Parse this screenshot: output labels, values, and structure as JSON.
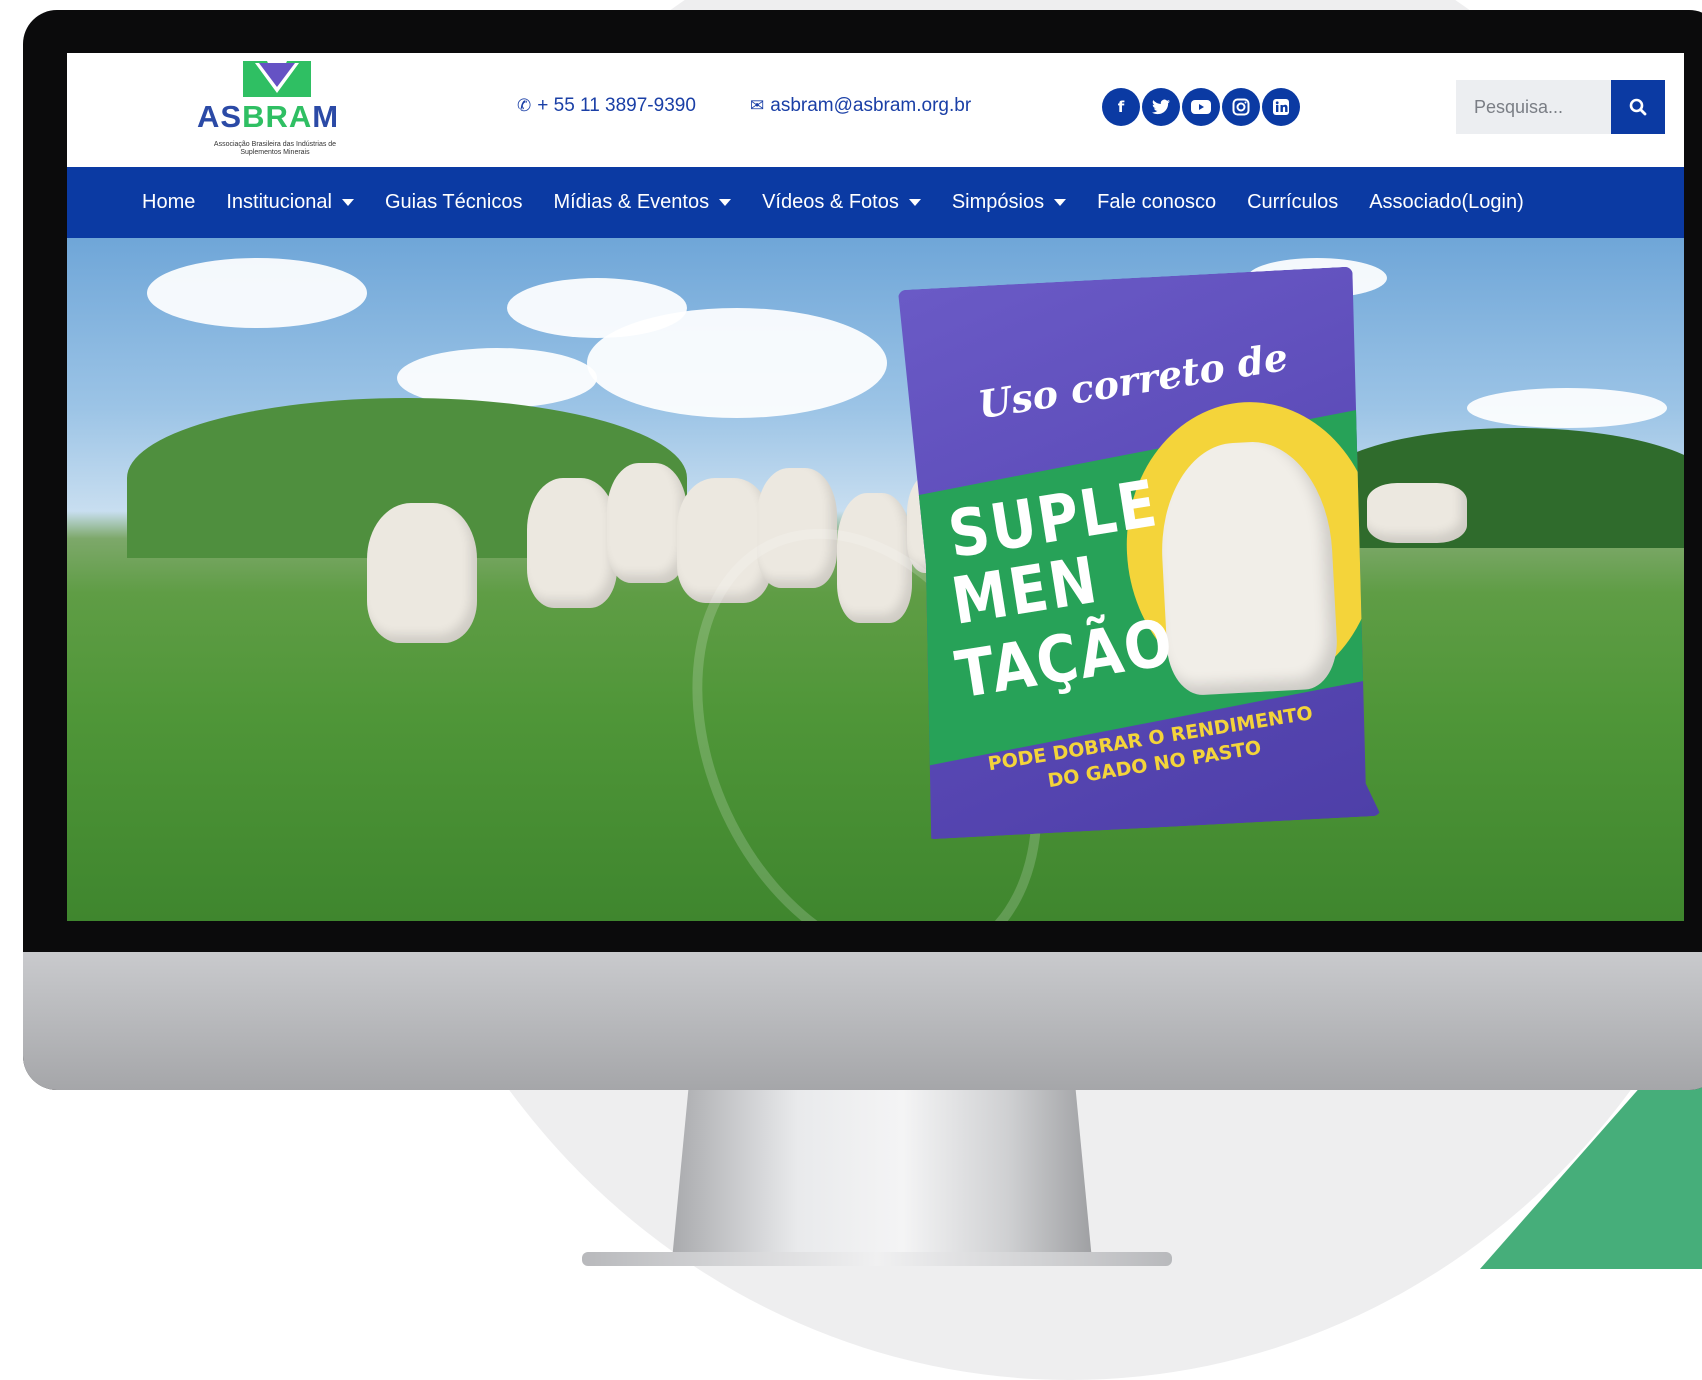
{
  "brand": {
    "logo_word_a": "AS",
    "logo_word_b": "BRA",
    "logo_word_c": "M",
    "logo_subtitle": "Associação Brasileira das Indústrias de Suplementos Minerais"
  },
  "header": {
    "phone": "+ 55 11 3897-9390",
    "email": "asbram@asbram.org.br",
    "social_icons": [
      "facebook-icon",
      "twitter-icon",
      "youtube-icon",
      "instagram-icon",
      "linkedin-icon"
    ],
    "search_placeholder": "Pesquisa..."
  },
  "nav": {
    "items": [
      {
        "label": "Home",
        "dropdown": false
      },
      {
        "label": "Institucional",
        "dropdown": true
      },
      {
        "label": "Guias Técnicos",
        "dropdown": false
      },
      {
        "label": "Mídias & Eventos",
        "dropdown": true
      },
      {
        "label": "Vídeos & Fotos",
        "dropdown": true
      },
      {
        "label": "Simpósios",
        "dropdown": true
      },
      {
        "label": "Fale conosco",
        "dropdown": false
      },
      {
        "label": "Currículos",
        "dropdown": false
      },
      {
        "label": "Associado(Login)",
        "dropdown": false
      }
    ]
  },
  "hero": {
    "bag_title": "Uso correto de",
    "bag_word_1": "SUPLE",
    "bag_word_2": "MEN",
    "bag_word_3": "TAÇÃO",
    "bag_footer_1": "PODE DOBRAR O RENDIMENTO",
    "bag_footer_2": "DO GADO NO PASTO"
  },
  "colors": {
    "primary_blue": "#0b3aa3",
    "brand_green": "#2fbf63",
    "bag_purple": "#5a49b6",
    "bag_green": "#27a258",
    "bag_yellow": "#f4d43a",
    "accent_green": "#46ae7a"
  }
}
